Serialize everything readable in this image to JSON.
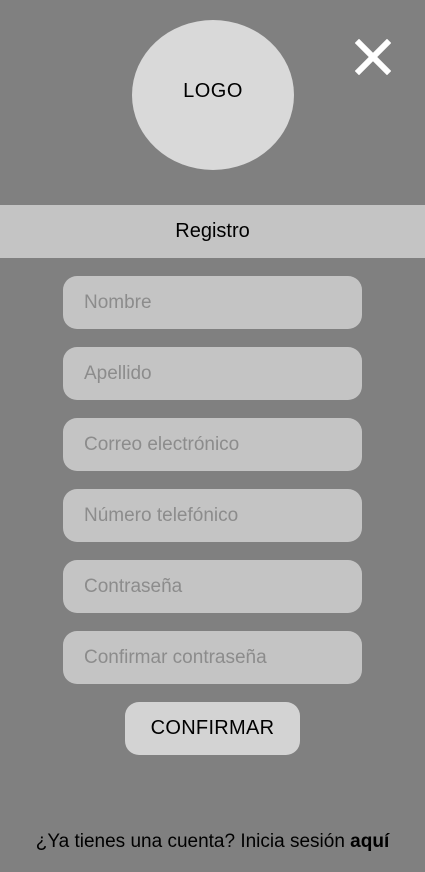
{
  "header": {
    "logo_text": "LOGO",
    "close_icon": "close-icon"
  },
  "title": "Registro",
  "form": {
    "fields": [
      {
        "placeholder": "Nombre",
        "value": ""
      },
      {
        "placeholder": "Apellido",
        "value": ""
      },
      {
        "placeholder": "Correo electrónico",
        "value": ""
      },
      {
        "placeholder": "Número telefónico",
        "value": ""
      },
      {
        "placeholder": "Contraseña",
        "value": ""
      },
      {
        "placeholder": "Confirmar contraseña",
        "value": ""
      }
    ],
    "confirm_label": "CONFIRMAR"
  },
  "footer": {
    "text": "¿Ya tienes una cuenta? Inicia sesión ",
    "link_text": "aquí"
  },
  "colors": {
    "background": "#808080",
    "panel": "#c4c4c4",
    "logo": "#d9d9d9",
    "close_icon": "#ffffff"
  }
}
